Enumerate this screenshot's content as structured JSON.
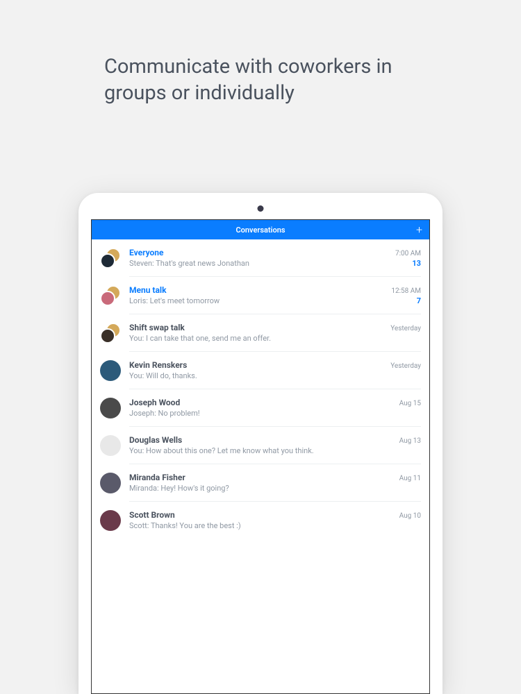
{
  "headline": "Communicate with coworkers in groups or individually",
  "header": {
    "title": "Conversations",
    "add_label": "+"
  },
  "conversations": [
    {
      "title": "Everyone",
      "preview": "Steven: That's great news Jonathan",
      "time": "7:00 AM",
      "badge": "13",
      "unread": true,
      "group": true,
      "avatar_a": "#1e2a36",
      "avatar_b": "#d4a95a"
    },
    {
      "title": "Menu talk",
      "preview": "Loris: Let's meet tomorrow",
      "time": "12:58 AM",
      "badge": "7",
      "unread": true,
      "group": true,
      "avatar_a": "#c96a7a",
      "avatar_b": "#d4a95a"
    },
    {
      "title": "Shift swap talk",
      "preview": "You: I can take that one, send me an offer.",
      "time": "Yesterday",
      "badge": "",
      "unread": false,
      "group": true,
      "avatar_a": "#3a3028",
      "avatar_b": "#d4a95a"
    },
    {
      "title": "Kevin Renskers",
      "preview": "You: Will do, thanks.",
      "time": "Yesterday",
      "badge": "",
      "unread": false,
      "group": false,
      "avatar_a": "#2c5a7a",
      "avatar_b": ""
    },
    {
      "title": "Joseph Wood",
      "preview": "Joseph: No problem!",
      "time": "Aug 15",
      "badge": "",
      "unread": false,
      "group": false,
      "avatar_a": "#4a4a4a",
      "avatar_b": ""
    },
    {
      "title": "Douglas Wells",
      "preview": "You: How about this one? Let me know what you think.",
      "time": "Aug 13",
      "badge": "",
      "unread": false,
      "group": false,
      "avatar_a": "#e8e8e8",
      "avatar_b": ""
    },
    {
      "title": "Miranda Fisher",
      "preview": "Miranda: Hey! How's it going?",
      "time": "Aug 11",
      "badge": "",
      "unread": false,
      "group": false,
      "avatar_a": "#5a5a6a",
      "avatar_b": ""
    },
    {
      "title": "Scott Brown",
      "preview": "Scott: Thanks! You are the best :)",
      "time": "Aug 10",
      "badge": "",
      "unread": false,
      "group": false,
      "avatar_a": "#6a3a4a",
      "avatar_b": ""
    }
  ]
}
